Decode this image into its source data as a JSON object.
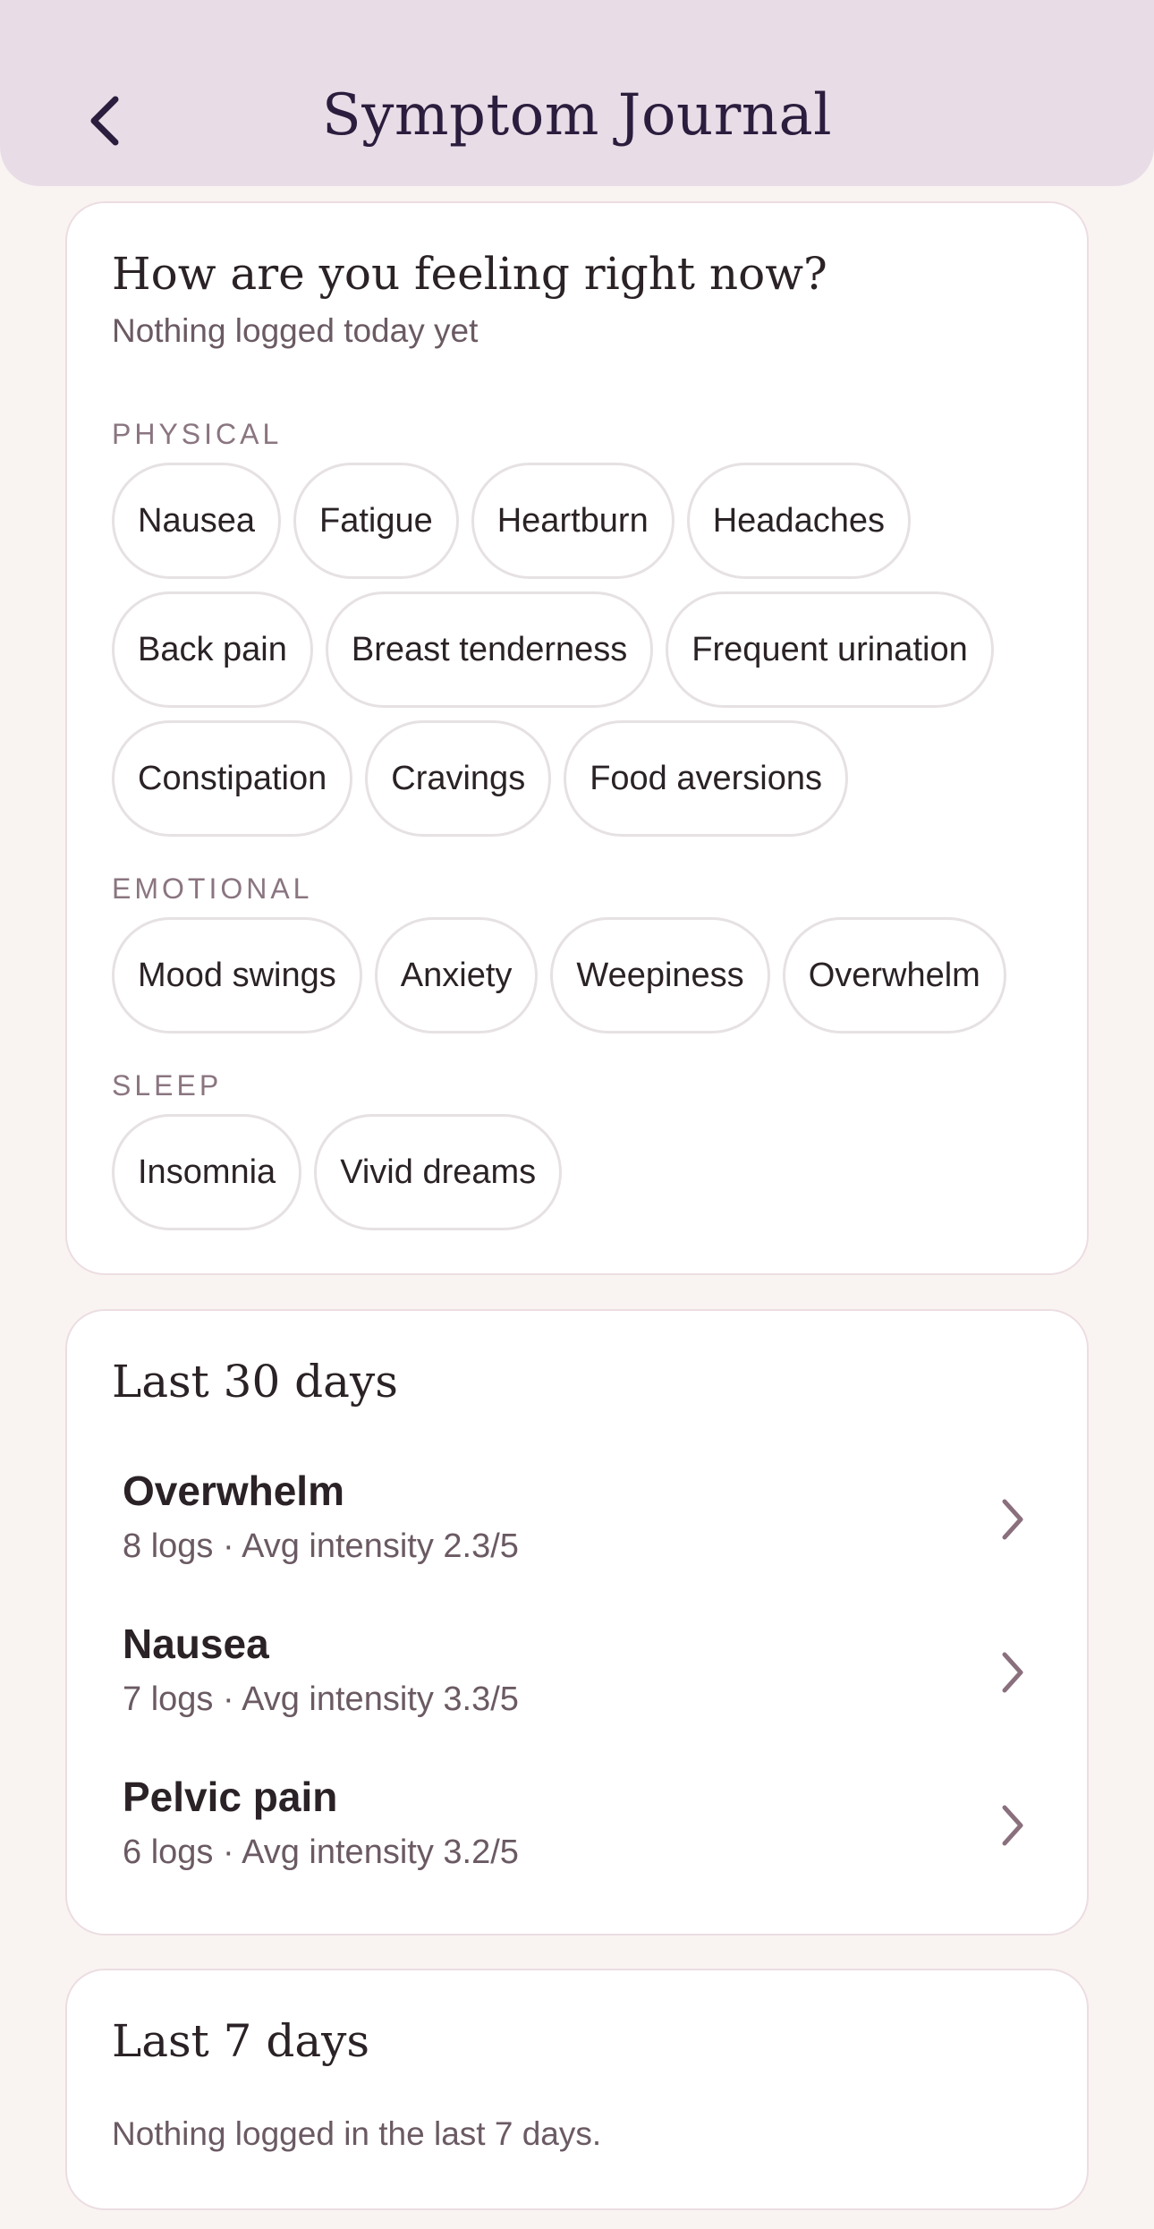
{
  "header": {
    "title": "Symptom Journal",
    "back_icon": "chevron-left-icon"
  },
  "feeling_card": {
    "title": "How are you feeling right now?",
    "subtitle": "Nothing logged today yet",
    "sections": [
      {
        "label": "PHYSICAL",
        "rows": [
          [
            "Nausea",
            "Fatigue",
            "Heartburn",
            "Headaches"
          ],
          [
            "Back pain",
            "Breast tenderness",
            "Frequent urination"
          ],
          [
            "Constipation",
            "Cravings",
            "Food aversions"
          ]
        ]
      },
      {
        "label": "EMOTIONAL",
        "rows": [
          [
            "Mood swings",
            "Anxiety",
            "Weepiness",
            "Overwhelm"
          ]
        ]
      },
      {
        "label": "SLEEP",
        "rows": [
          [
            "Insomnia",
            "Vivid dreams"
          ]
        ]
      }
    ]
  },
  "last30": {
    "title": "Last 30 days",
    "items": [
      {
        "name": "Overwhelm",
        "meta": "8 logs · Avg intensity 2.3/5"
      },
      {
        "name": "Nausea",
        "meta": "7 logs · Avg intensity 3.3/5"
      },
      {
        "name": "Pelvic pain",
        "meta": "6 logs · Avg intensity 3.2/5"
      }
    ]
  },
  "last7": {
    "title": "Last 7 days",
    "empty_text": "Nothing logged in the last 7 days."
  },
  "colors": {
    "header_bg": "#e8dde7",
    "title_color": "#2b1d3d",
    "page_bg": "#f9f4f2",
    "chevron": "#8a6f7d"
  }
}
